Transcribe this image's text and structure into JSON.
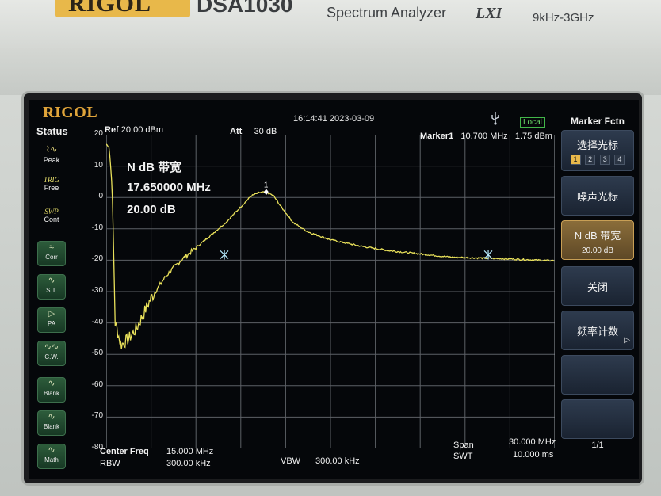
{
  "panel": {
    "brand": "RIGOL",
    "model": "DSA1030",
    "product_type": "Spectrum Analyzer",
    "lxi": "LXI",
    "freq_range": "9kHz-3GHz"
  },
  "screen": {
    "logo": "RIGOL",
    "time": "16:14:41 2023-03-09",
    "remote_mode": "Local",
    "status_title": "Status",
    "status_items": [
      {
        "label": "Peak",
        "icon": "peak-wave-icon"
      },
      {
        "label": "Free",
        "icon": "trig-icon",
        "caption": "TRIG"
      },
      {
        "label": "Cont",
        "icon": "swp-icon",
        "caption": "SWP"
      },
      {
        "label": "Corr",
        "icon": "corr-icon"
      },
      {
        "label": "S.T.",
        "icon": "wave-icon"
      },
      {
        "label": "PA",
        "icon": "amplifier-icon"
      },
      {
        "label": "C.W.",
        "icon": "wave-icon"
      },
      {
        "label": "Blank",
        "icon": "wave-icon"
      },
      {
        "label": "Blank",
        "icon": "wave-icon"
      },
      {
        "label": "Math",
        "icon": "wave-icon"
      }
    ],
    "header": {
      "ref_label": "Ref",
      "ref_value": "20.00 dBm",
      "att_label": "Att",
      "att_value": "30 dB",
      "marker_label": "Marker1",
      "marker_freq": "10.700 MHz",
      "marker_ampl": "1.75 dBm"
    },
    "y_ticks": [
      "20",
      "10",
      "0",
      "-10",
      "-20",
      "-30",
      "-40",
      "-50",
      "-60",
      "-70",
      "-80"
    ],
    "readout": {
      "title": "N dB 带宽",
      "bandwidth": "17.650000 MHz",
      "ndb": "20.00 dB"
    },
    "marker_number": "1",
    "footer": {
      "center_label": "Center Freq",
      "center_value": "15.000 MHz",
      "rbw_label": "RBW",
      "rbw_value": "300.00 kHz",
      "vbw_label": "VBW",
      "vbw_value": "300.00 kHz",
      "span_label": "Span",
      "span_value": "30.000 MHz",
      "swt_label": "SWT",
      "swt_value": "10.000 ms"
    },
    "menu": {
      "title": "Marker Fctn",
      "select_marker": "选择光标",
      "marker_numbers": [
        "1",
        "2",
        "3",
        "4"
      ],
      "selected_marker": "1",
      "noise_marker": "噪声光标",
      "ndb_bw": "N dB 带宽",
      "ndb_value": "20.00 dB",
      "off": "关闭",
      "freq_count": "频率计数",
      "page": "1/1"
    }
  },
  "chart_data": {
    "type": "line",
    "xlabel": "",
    "ylabel": "",
    "x_unit": "MHz",
    "y_unit": "dBm",
    "xlim": [
      0,
      30
    ],
    "ylim": [
      -80,
      20
    ],
    "grid": true,
    "series": [
      {
        "x": [
          0.0,
          0.2,
          0.4,
          0.6,
          1.0,
          1.5,
          2.0,
          3.0,
          4.0,
          5.0,
          6.0,
          7.0,
          8.0,
          9.0,
          9.7,
          10.2,
          10.7,
          11.2,
          11.7,
          12.5,
          13.5,
          15.0,
          17.0,
          19.0,
          21.0,
          23.0,
          25.0,
          27.0,
          28.0,
          29.0,
          30.0
        ],
        "y": [
          17,
          16,
          3,
          -40,
          -47,
          -45,
          -42,
          -32,
          -25,
          -20,
          -16,
          -12,
          -8,
          -3,
          0.5,
          1.5,
          1.75,
          0.5,
          -3,
          -8,
          -11,
          -13.5,
          -15.5,
          -17,
          -18,
          -19,
          -19.3,
          -19.6,
          -19.8,
          -20,
          -20.2
        ]
      }
    ],
    "markers": [
      {
        "name": "1",
        "x": 10.7,
        "y": 1.75
      },
      {
        "name": "ndb-left",
        "x": 7.9,
        "y": -18.25
      },
      {
        "name": "ndb-right",
        "x": 25.55,
        "y": -18.25
      }
    ]
  }
}
